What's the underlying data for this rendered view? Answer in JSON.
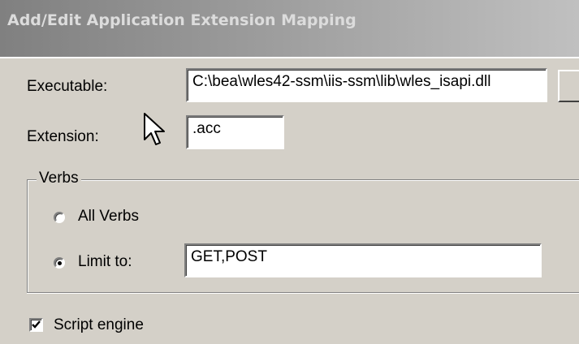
{
  "dialog": {
    "title": "Add/Edit Application Extension Mapping"
  },
  "executable": {
    "label": "Executable:",
    "value": "C:\\bea\\wles42-ssm\\iis-ssm\\lib\\wles_isapi.dll"
  },
  "extension": {
    "label": "Extension:",
    "value": ".acc"
  },
  "verbs": {
    "group_label": "Verbs",
    "all_verbs_label": "All Verbs",
    "all_verbs_selected": false,
    "limit_to_label": "Limit to:",
    "limit_to_selected": true,
    "limit_to_value": "GET,POST"
  },
  "script_engine": {
    "label": "Script engine",
    "checked": true
  },
  "icons": {
    "cursor": "arrow-pointer-icon",
    "check": "checkmark-icon"
  },
  "colors": {
    "dialog_face": "#d4d0c8",
    "title_gradient_start": "#808080",
    "title_gradient_end": "#c0c0c0",
    "title_text": "#dcdcdc"
  }
}
